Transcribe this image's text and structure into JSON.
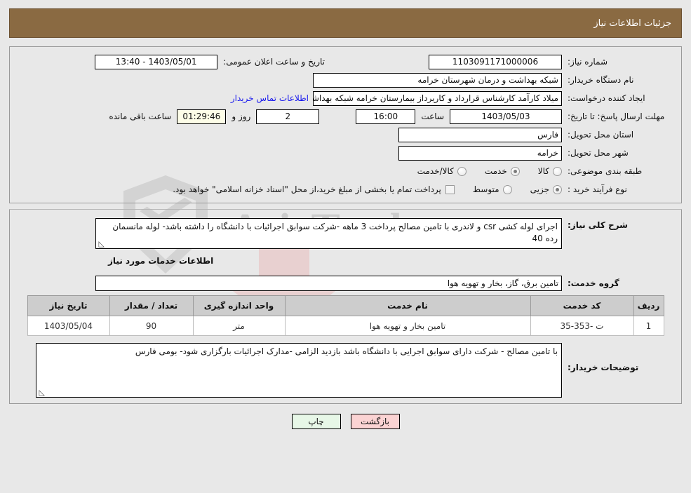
{
  "header": {
    "title": "جزئیات اطلاعات نیاز"
  },
  "fields": {
    "need_number_label": "شماره نیاز:",
    "need_number_value": "1103091171000006",
    "announce_label": "تاریخ و ساعت اعلان عمومی:",
    "announce_value": "1403/05/01 - 13:40",
    "buyer_org_label": "نام دستگاه خریدار:",
    "buyer_org_value": "شبکه بهداشت و درمان شهرستان خرامه",
    "creator_label": "ایجاد کننده درخواست:",
    "creator_value": "میلاد کارآمد کارشناس قرارداد و کاریرداز بیمارستان خرامه شبکه بهداشت و درمان",
    "buyer_contact_link": "اطلاعات تماس خریدار",
    "deadline_label": "مهلت ارسال پاسخ: تا تاریخ:",
    "deadline_date": "1403/05/03",
    "hour_label": "ساعت",
    "deadline_time": "16:00",
    "days_value": "2",
    "days_label": "روز و",
    "timer_value": "01:29:46",
    "remaining_label": "ساعت باقی مانده",
    "province_label": "استان محل تحویل:",
    "province_value": "فارس",
    "city_label": "شهر محل تحویل:",
    "city_value": "خرامه",
    "category_label": "طبقه بندی موضوعی:",
    "purchase_type_label": "نوع فرآیند خرید :",
    "treasury_note": "پرداخت تمام یا بخشی از مبلغ خرید،از محل \"اسناد خزانه اسلامی\" خواهد بود."
  },
  "category_options": [
    {
      "label": "کالا",
      "selected": false
    },
    {
      "label": "خدمت",
      "selected": true
    },
    {
      "label": "کالا/خدمت",
      "selected": false
    }
  ],
  "purchase_options": [
    {
      "label": "جزیی",
      "selected": true
    },
    {
      "label": "متوسط",
      "selected": false
    }
  ],
  "description": {
    "label": "شرح کلی نیاز:",
    "value": "اجرای لوله کشی csr و لاندری با تامین مصالح  پرداخت 3 ماهه -شرکت سوابق اجرائیات با دانشگاه را داشته باشد- لوله مانسمان رده 40",
    "resize_grip": "◺"
  },
  "services_section": {
    "section_title": "اطلاعات خدمات مورد نیاز",
    "group_label": "گروه خدمت:",
    "group_value": "تامین برق، گاز، بخار و تهویه هوا"
  },
  "table": {
    "headers": [
      "ردیف",
      "کد خدمت",
      "نام خدمت",
      "واحد اندازه گیری",
      "تعداد / مقدار",
      "تاریخ نیاز"
    ],
    "rows": [
      {
        "row": "1",
        "code": "ت -353-35",
        "name": "تامین بخار و تهویه هوا",
        "unit": "متر",
        "qty": "90",
        "date": "1403/05/04"
      }
    ]
  },
  "notes": {
    "label": "توضیحات خریدار:",
    "value": "با تامین مصالح - شرکت دارای سوابق اجرایی با دانشگاه باشد بازدید الزامی -مدارک اجرائیات بارگزاری شود- بومی فارس",
    "resize_grip": "◺"
  },
  "footer": {
    "print_label": "چاپ",
    "back_label": "بازگشت"
  },
  "watermark": {
    "text": "AriaTender.net",
    "text2": "Tender"
  },
  "colors": {
    "header_bar": "#8a6a42",
    "page_bg": "#e8e8e8",
    "link": "#1a1aee",
    "print_btn": "#e7f7e7",
    "back_btn": "#fbd3d3",
    "timer_bg": "#fdfde8",
    "table_header": "#cdcdcd"
  }
}
